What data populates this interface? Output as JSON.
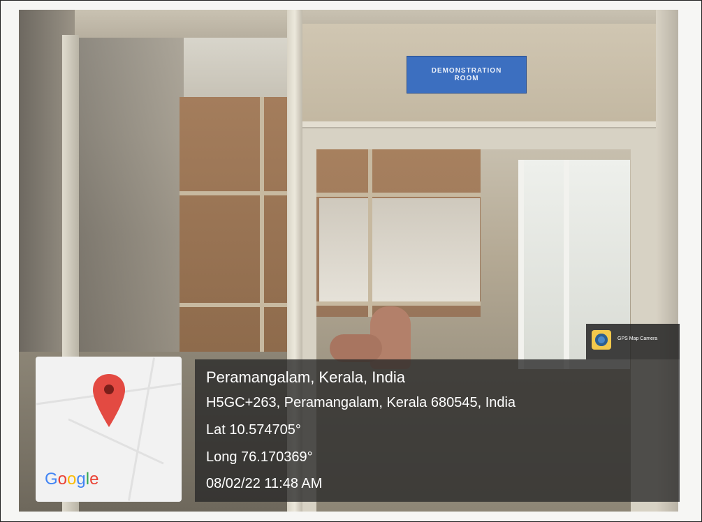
{
  "photo": {
    "sign_line1": "DEMONSTRATION",
    "sign_line2": "ROOM"
  },
  "map_card": {
    "provider_logo": "Google",
    "pin_icon": "location-pin-icon",
    "pin_color": "#e34a42"
  },
  "stamp": {
    "place": "Peramangalam, Kerala, India",
    "address": "H5GC+263, Peramangalam, Kerala 680545, India",
    "latitude": "Lat 10.574705°",
    "longitude": "Long 76.170369°",
    "datetime": "08/02/22 11:48 AM"
  },
  "app_badge": {
    "name": "GPS Map Camera",
    "icon": "camera-app-icon"
  }
}
